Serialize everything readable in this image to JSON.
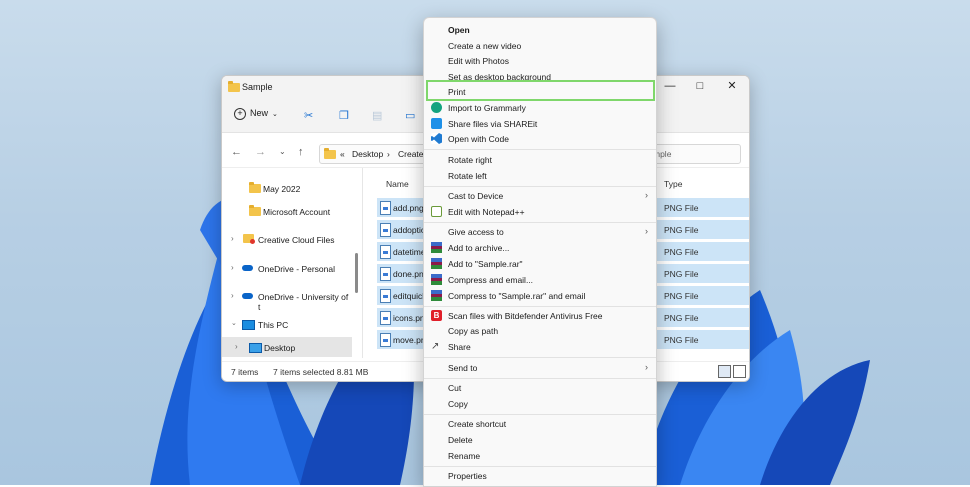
{
  "explorer": {
    "title": "Sample",
    "toolbar": {
      "new_label": "New"
    },
    "address": {
      "prefix": "«",
      "crumb1": "Desktop",
      "sep": "›",
      "crumb2": "Createo",
      "search_placeholder": "mple"
    },
    "nav_items": [
      {
        "label": "May 2022",
        "icon": "folder-icon"
      },
      {
        "label": "Microsoft Account",
        "icon": "folder-icon"
      },
      {
        "label": "Creative Cloud Files",
        "icon": "creative-cloud-icon"
      },
      {
        "label": "OneDrive - Personal",
        "icon": "onedrive-icon"
      },
      {
        "label": "OneDrive - University of t",
        "icon": "onedrive-icon"
      },
      {
        "label": "This PC",
        "icon": "pc-icon"
      },
      {
        "label": "Desktop",
        "icon": "desktop-icon"
      }
    ],
    "columns": {
      "name": "Name",
      "type": "Type"
    },
    "files": [
      {
        "name": "add.png",
        "type": "PNG File"
      },
      {
        "name": "addoptio",
        "type": "PNG File"
      },
      {
        "name": "datetime",
        "type": "PNG File"
      },
      {
        "name": "done.pn",
        "type": "PNG File"
      },
      {
        "name": "editquicl",
        "type": "PNG File"
      },
      {
        "name": "icons.pn",
        "type": "PNG File"
      },
      {
        "name": "move.pn",
        "type": "PNG File"
      }
    ],
    "status": {
      "count": "7 items",
      "selected": "7 items selected  8.81 MB"
    }
  },
  "menu": {
    "items": [
      "Open",
      "Create a new video",
      "Edit with Photos",
      "Set as desktop background",
      "Print",
      "Import to Grammarly",
      "Share files via SHAREit",
      "Open with Code",
      "Rotate right",
      "Rotate left",
      "Cast to Device",
      "Edit with Notepad++",
      "Give access to",
      "Add to archive...",
      "Add to \"Sample.rar\"",
      "Compress and email...",
      "Compress to \"Sample.rar\" and email",
      "Scan files with Bitdefender Antivirus Free",
      "Copy as path",
      "Share",
      "Send to",
      "Cut",
      "Copy",
      "Create shortcut",
      "Delete",
      "Rename",
      "Properties"
    ],
    "highlighted": "Print",
    "highlight_color": "#7fd76b"
  }
}
